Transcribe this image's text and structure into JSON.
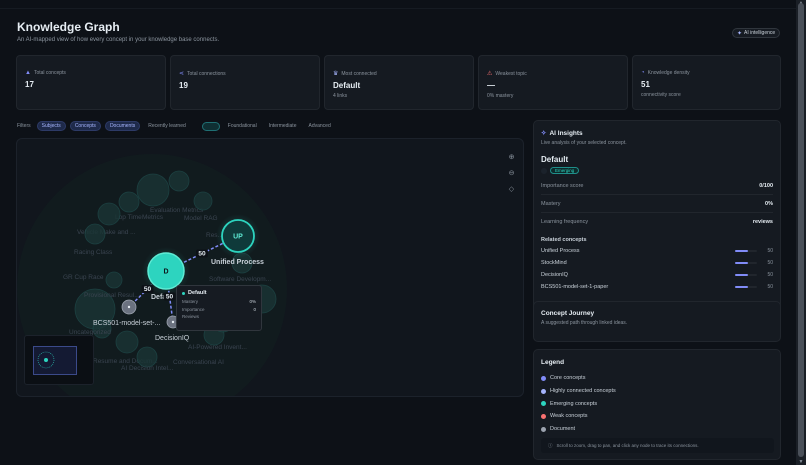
{
  "header": {
    "title": "Knowledge Graph",
    "subtitle": "An AI-mapped view of how every concept in your knowledge base connects.",
    "badge": "AI intelligence"
  },
  "stats": [
    {
      "icon": "graduation-cap-icon",
      "label": "Total concepts",
      "value": "17",
      "sub": ""
    },
    {
      "icon": "share-nodes-icon",
      "label": "Total connections",
      "value": "19",
      "sub": ""
    },
    {
      "icon": "crown-icon",
      "label": "Most connected",
      "value": "Default",
      "sub": "4 links"
    },
    {
      "icon": "warning-triangle-icon",
      "label": "Weakest topic",
      "value": "—",
      "sub": "0% mastery"
    },
    {
      "icon": "gauge-icon",
      "label": "Knowledge density",
      "value": "51",
      "sub": "connectivity score"
    }
  ],
  "filters": {
    "label": "Filters",
    "chips": [
      {
        "label": "Subjects",
        "active": true
      },
      {
        "label": "Concepts",
        "active": true
      },
      {
        "label": "Documents",
        "active": true
      },
      {
        "label": "Recently learned",
        "active": false
      }
    ],
    "levels": [
      "Foundational",
      "Intermediate",
      "Advanced"
    ]
  },
  "chart_data": {
    "type": "network",
    "nodes": [
      {
        "id": "default",
        "label": "Default",
        "initial": "D",
        "group": "emerging",
        "highlighted": true
      },
      {
        "id": "up",
        "label": "Unified Process",
        "initial": "UP",
        "group": "emerging",
        "highlighted": true
      },
      {
        "id": "bcs501",
        "label": "BCS501-model-set-...",
        "group": "document"
      },
      {
        "id": "decisioniq",
        "label": "DecisionIQ",
        "group": "document"
      },
      {
        "id": "evaluation",
        "label": "Evaluation Metrics",
        "group": "dim"
      },
      {
        "id": "modelrag",
        "label": "Model RAG",
        "group": "dim"
      },
      {
        "id": "loptime",
        "label": "Lop Time",
        "group": "dim"
      },
      {
        "id": "metrics",
        "label": "Metrics",
        "group": "dim"
      },
      {
        "id": "vehicle",
        "label": "Vehicle Make and ...",
        "group": "dim"
      },
      {
        "id": "racing",
        "label": "Racing Class",
        "group": "dim"
      },
      {
        "id": "grcup",
        "label": "GR Cup Race",
        "group": "dim"
      },
      {
        "id": "provisional",
        "label": "Provisional Resul...",
        "group": "dim"
      },
      {
        "id": "software",
        "label": "Software Developm...",
        "group": "dim"
      },
      {
        "id": "uncategorized",
        "label": "Uncategorized",
        "group": "dim"
      },
      {
        "id": "resume",
        "label": "Resume and Docum...",
        "group": "dim"
      },
      {
        "id": "conversational",
        "label": "Conversational AI",
        "group": "dim"
      },
      {
        "id": "aipowered",
        "label": "AI-Powered Invent...",
        "group": "dim"
      },
      {
        "id": "aidecision",
        "label": "AI Decision Intel...",
        "group": "dim"
      },
      {
        "id": "research",
        "label": "Res...",
        "group": "dim"
      }
    ],
    "edges": [
      {
        "source": "default",
        "target": "up",
        "weight": 50
      },
      {
        "source": "default",
        "target": "bcs501",
        "weight": 50
      },
      {
        "source": "default",
        "target": "decisioniq",
        "weight": 50
      }
    ]
  },
  "tooltip": {
    "title": "Default",
    "rows": [
      {
        "label": "Mastery",
        "value": "0%"
      },
      {
        "label": "Importance",
        "value": "0"
      },
      {
        "label": "Reviews",
        "value": ""
      }
    ]
  },
  "insights": {
    "title": "AI Insights",
    "subtitle": "Live analysis of your selected concept.",
    "concept": "Default",
    "badge": "Emerging",
    "metrics": [
      {
        "label": "Importance score",
        "value": "0/100"
      },
      {
        "label": "Mastery",
        "value": "0%"
      },
      {
        "label": "Learning frequency",
        "value": "reviews"
      }
    ],
    "related_title": "Related concepts",
    "related": [
      {
        "name": "Unified Process",
        "value": "50",
        "strength": 0.6
      },
      {
        "name": "StockMind",
        "value": "50",
        "strength": 0.6
      },
      {
        "name": "DecisionIQ",
        "value": "50",
        "strength": 0.6
      },
      {
        "name": "BCS501-model-set-1-paper",
        "value": "50",
        "strength": 0.6
      }
    ]
  },
  "journey": {
    "title": "Concept Journey",
    "subtitle": "A suggested path through linked ideas."
  },
  "legend": {
    "title": "Legend",
    "items": [
      {
        "label": "Core concepts",
        "color": "#818cf8"
      },
      {
        "label": "Highly connected concepts",
        "color": "#a5b4fc"
      },
      {
        "label": "Emerging concepts",
        "color": "#2dd4bf"
      },
      {
        "label": "Weak concepts",
        "color": "#f87171"
      },
      {
        "label": "Document",
        "color": "#9ca3af"
      }
    ],
    "hint": "Scroll to zoom, drag to pan, and click any node to trace its connections."
  }
}
